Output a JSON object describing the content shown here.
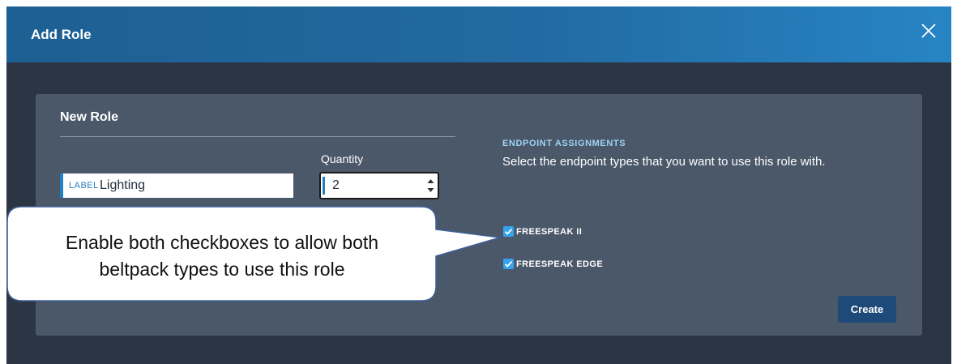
{
  "dialog": {
    "title": "Add Role",
    "close_icon": "close-icon"
  },
  "panel": {
    "title": "New Role",
    "label_field": {
      "prefix": "LABEL",
      "value": "Lighting"
    },
    "quantity": {
      "label": "Quantity",
      "value": "2"
    }
  },
  "endpoints": {
    "heading": "ENDPOINT ASSIGNMENTS",
    "description": "Select the endpoint types that you want to use this role with.",
    "options": [
      {
        "label": "FREESPEAK II",
        "checked": true
      },
      {
        "label": "FREESPEAK EDGE",
        "checked": true
      }
    ]
  },
  "actions": {
    "create_label": "Create"
  },
  "callout": {
    "line1": "Enable both checkboxes to allow both",
    "line2": "beltpack types to use this role"
  },
  "colors": {
    "title_bar": "#226aa1",
    "background": "#2b3544",
    "panel": "#4a5869",
    "accent": "#1f80c6",
    "checkbox": "#35a3ee",
    "heading": "#9fd3f5",
    "create_button": "#1d4a78"
  }
}
